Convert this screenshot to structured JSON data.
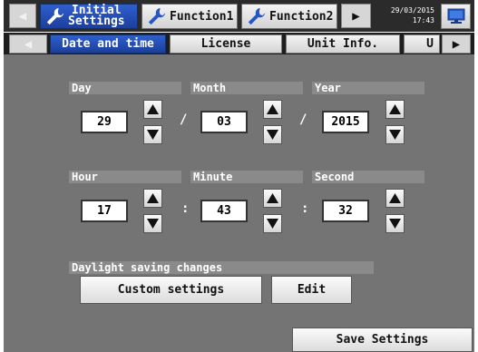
{
  "top_tabs": {
    "initial_settings_line1": "Initial",
    "initial_settings_line2": "Settings",
    "function1": "Function1",
    "function2": "Function2"
  },
  "clock": {
    "date": "29/03/2015",
    "time": "17:43"
  },
  "sub_tabs": [
    "Date and time",
    "License",
    "Unit Info.",
    "U"
  ],
  "date": {
    "day_label": "Day",
    "day_value": "29",
    "month_label": "Month",
    "month_value": "03",
    "year_label": "Year",
    "year_value": "2015",
    "separator": "/"
  },
  "time": {
    "hour_label": "Hour",
    "hour_value": "17",
    "minute_label": "Minute",
    "minute_value": "43",
    "second_label": "Second",
    "second_value": "32",
    "separator": ":"
  },
  "daylight": {
    "label": "Daylight saving changes",
    "custom_button": "Custom settings",
    "edit_button": "Edit"
  },
  "save_button": "Save Settings",
  "colors": {
    "active_tab": "#2a55c0",
    "panel": "#747474",
    "bar": "#2b2b2b"
  },
  "icons": [
    "wrench-icon",
    "arrow-left-icon",
    "arrow-right-icon",
    "monitor-icon",
    "triangle-up-icon",
    "triangle-down-icon"
  ]
}
